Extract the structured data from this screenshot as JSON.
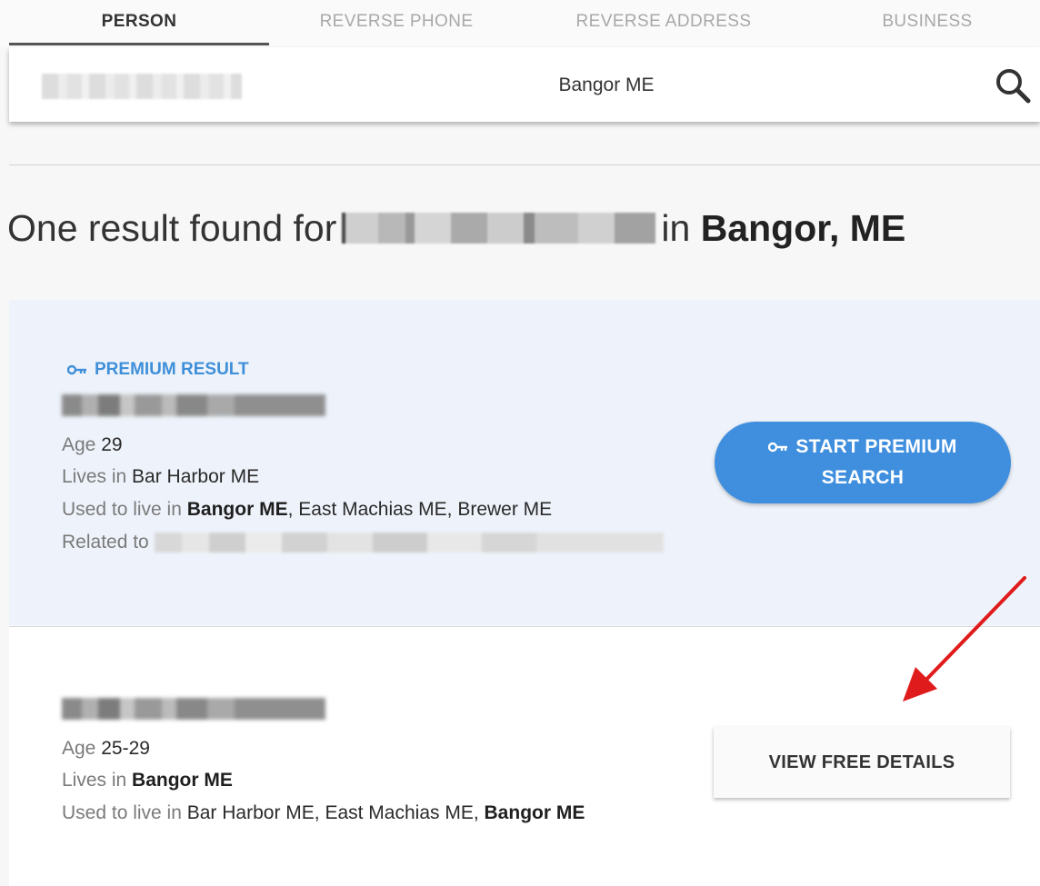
{
  "tabs": [
    {
      "label": "PERSON",
      "active": true
    },
    {
      "label": "REVERSE PHONE",
      "active": false
    },
    {
      "label": "REVERSE ADDRESS",
      "active": false
    },
    {
      "label": "BUSINESS",
      "active": false
    }
  ],
  "search": {
    "name_value": "",
    "location_value": "Bangor ME",
    "icon": "search-icon"
  },
  "heading": {
    "prefix": "One result found for",
    "in_word": "in",
    "location": "Bangor, ME"
  },
  "results": [
    {
      "tag": "PREMIUM RESULT",
      "tag_icon": "key-icon",
      "age_label": "Age",
      "age": "29",
      "lives_label": "Lives in",
      "lives": "Bar Harbor ME",
      "used_label": "Used to live in",
      "used_bold": "Bangor ME",
      "used_rest": ", East Machias ME, Brewer ME",
      "related_label": "Related to",
      "button_line1": "START PREMIUM",
      "button_line2": "SEARCH"
    },
    {
      "age_label": "Age",
      "age": "25-29",
      "lives_label": "Lives in",
      "lives": "Bangor ME",
      "used_label": "Used to live in",
      "used_rest": "Bar Harbor ME, East Machias ME, ",
      "used_bold": "Bangor ME",
      "button": "VIEW FREE DETAILS"
    }
  ],
  "colors": {
    "accent_blue": "#3f8fde",
    "premium_bg": "#eef3fb",
    "arrow_red": "#e01b1b"
  }
}
